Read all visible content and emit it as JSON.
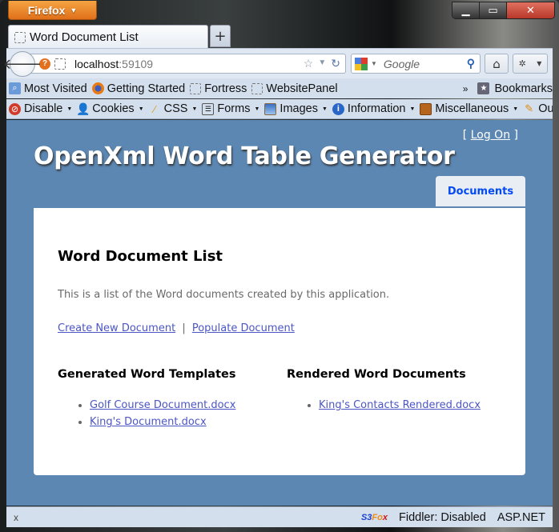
{
  "browser": {
    "app_button": "Firefox",
    "window_controls": {
      "minimize": "▁",
      "maximize": "▭",
      "close": "✕"
    },
    "tab": {
      "title": "Word Document List",
      "new_tab": "+"
    },
    "url": {
      "host": "localhost",
      "port": ":59109"
    },
    "search": {
      "placeholder": "Google"
    },
    "bookmarks_bar": {
      "items": [
        "Most Visited",
        "Getting Started",
        "Fortress",
        "WebsitePanel"
      ],
      "overflow": "»",
      "bookmarks_label": "Bookmarks"
    },
    "web_developer_bar": {
      "items": [
        "Disable",
        "Cookies",
        "CSS",
        "Forms",
        "Images",
        "Information",
        "Miscellaneous",
        "Outline"
      ]
    },
    "status_bar": {
      "close": "x",
      "s3fox": {
        "a": "S3",
        "b": "Fo",
        "c": "x"
      },
      "fiddler": "Fiddler: Disabled",
      "aspnet": "ASP.NET"
    }
  },
  "site": {
    "login": {
      "open": "[",
      "link": "Log On",
      "close": "]"
    },
    "title": "OpenXml Word Table Generator",
    "menu": [
      {
        "label": "Documents",
        "active": true
      }
    ],
    "accent_link_color": "#4b55c4",
    "menu_color": "#034af3",
    "header_bg": "#5c87b2"
  },
  "main": {
    "heading": "Word Document List",
    "description": "This is a list of the Word documents created by this application.",
    "actions": {
      "create": "Create New Document",
      "separator": "|",
      "populate": "Populate Document"
    },
    "templates": {
      "heading": "Generated Word Templates",
      "items": [
        "Golf Course Document.docx",
        "King's Document.docx"
      ]
    },
    "rendered": {
      "heading": "Rendered Word Documents",
      "items": [
        "King's Contacts Rendered.docx"
      ]
    }
  }
}
